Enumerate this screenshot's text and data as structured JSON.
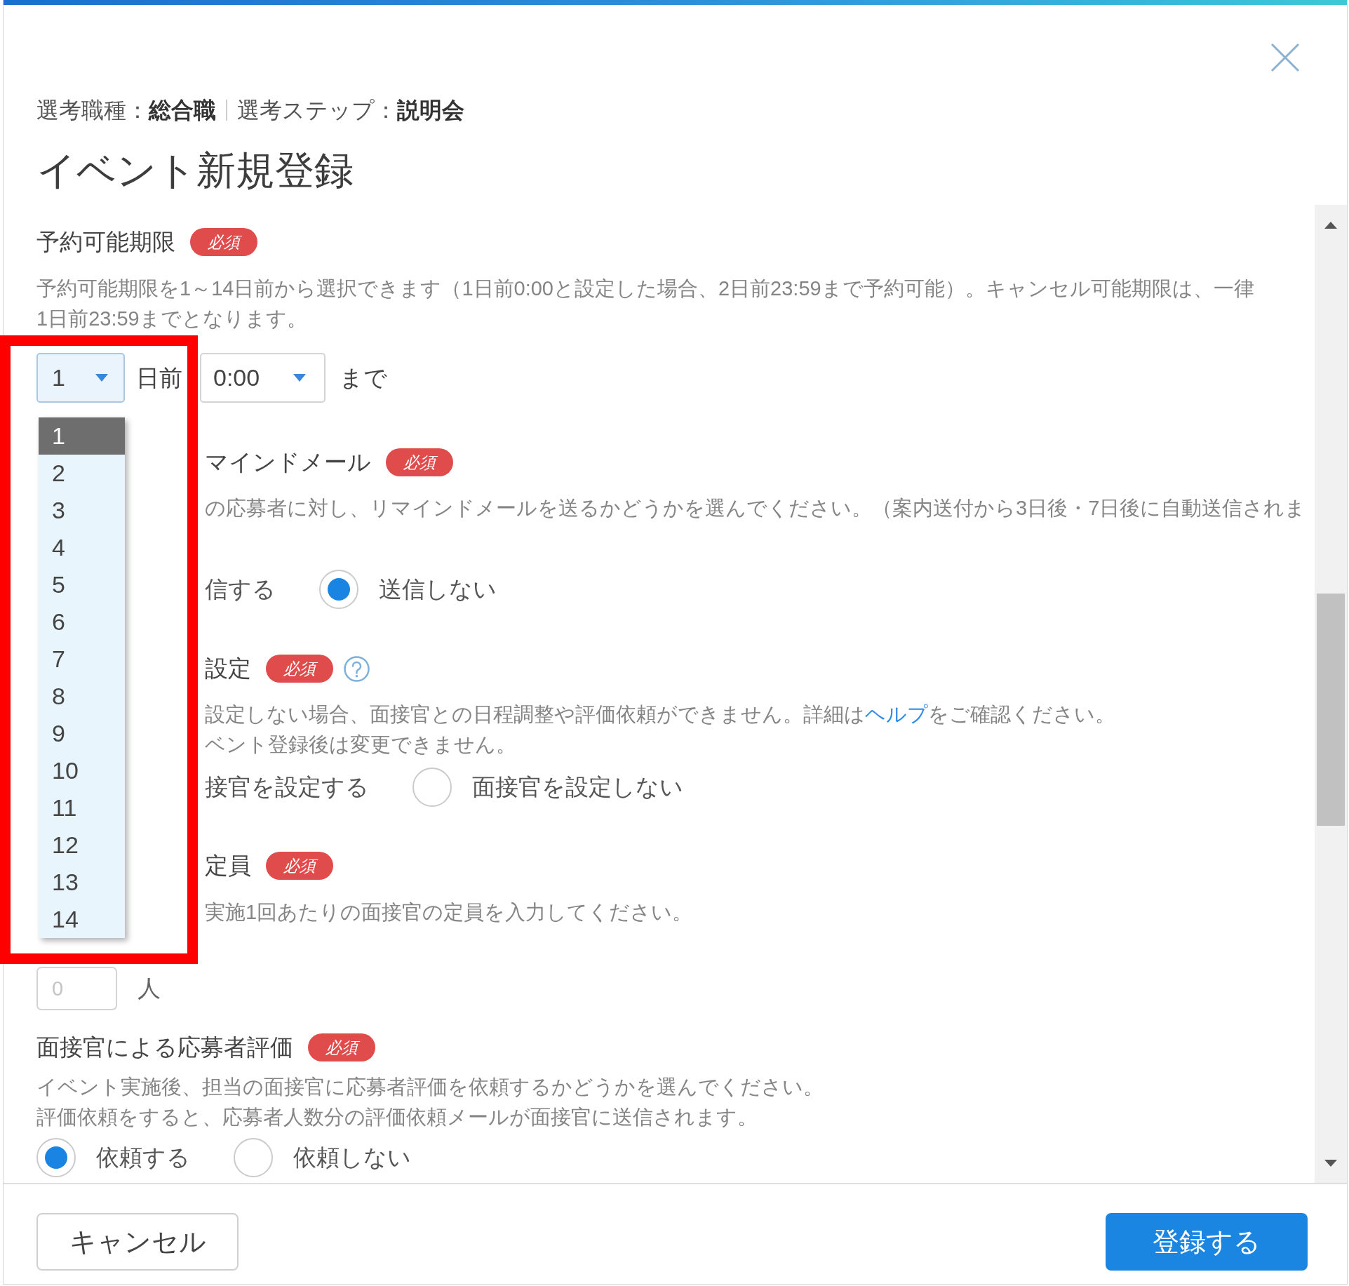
{
  "dialog": {
    "breadcrumb": [
      "選考職種：**総合職**",
      "選考ステップ：**説明会**"
    ],
    "title": "イベント新規登録"
  },
  "sections": [
    {
      "kind": "deadline",
      "label": "予約可能期限",
      "badge": "必須",
      "description": [
        "予約可能期限を1～14日前から選択できます（1日前0:00と設定した場合、2日前23:59まで予約可能）。キャンセル可能期限は、一律",
        "1日前23:59までとなります。"
      ],
      "day_select": {
        "value": "1",
        "open": true,
        "options": [
          {
            "label": "1",
            "selected": true
          },
          {
            "label": "2",
            "selected": false
          },
          {
            "label": "3",
            "selected": false
          },
          {
            "label": "4",
            "selected": false
          },
          {
            "label": "5",
            "selected": false
          },
          {
            "label": "6",
            "selected": false
          },
          {
            "label": "7",
            "selected": false
          },
          {
            "label": "8",
            "selected": false
          },
          {
            "label": "9",
            "selected": false
          },
          {
            "label": "10",
            "selected": false
          },
          {
            "label": "11",
            "selected": false
          },
          {
            "label": "12",
            "selected": false
          },
          {
            "label": "13",
            "selected": false
          },
          {
            "label": "14",
            "selected": false
          }
        ]
      },
      "day_unit": "日前",
      "time_select": {
        "value": "0:00"
      },
      "suffix": "まで"
    },
    {
      "kind": "radio",
      "label": "マインドメール",
      "badge": "必須",
      "description": [
        "の応募者に対し、リマインドメールを送るかどうかを選んでください。（案内送付から3日後・7日後に自動送信されま"
      ],
      "options": [
        {
          "label": "信する"
        },
        {
          "label": "送信しない",
          "selected": true
        }
      ]
    },
    {
      "kind": "radio",
      "label": "設定",
      "badge": "必須",
      "help": true,
      "description": [
        [
          {
            "kind": "text",
            "text": "設定しない場合、面接官との日程調整や評価依頼ができません。詳細は"
          },
          {
            "kind": "link",
            "text": "ヘルプ"
          },
          {
            "kind": "text",
            "text": "をご確認ください。"
          }
        ],
        "ベント登録後は変更できません。"
      ],
      "options": [
        {
          "label": "接官を設定する"
        },
        {
          "label": "面接官を設定しない",
          "selected": false
        }
      ]
    },
    {
      "kind": "number",
      "label": "定員",
      "badge": "必須",
      "description": [
        "実施1回あたりの面接官の定員を入力してください。"
      ],
      "input": {
        "placeholder": "0"
      },
      "unit": "人"
    },
    {
      "kind": "radio",
      "label": "面接官による応募者評価",
      "badge": "必須",
      "description": [
        "イベント実施後、担当の面接官に応募者評価を依頼するかどうかを選んでください。",
        "評価依頼をすると、応募者人数分の評価依頼メールが面接官に送信されます。"
      ],
      "options": [
        {
          "label": "依頼する",
          "selected": true
        },
        {
          "label": "依頼しない",
          "selected": false
        }
      ]
    }
  ],
  "footer": {
    "buttons": [
      {
        "kind": "secondary",
        "label": "キャンセル"
      },
      {
        "kind": "primary",
        "label": "登録する"
      }
    ]
  }
}
